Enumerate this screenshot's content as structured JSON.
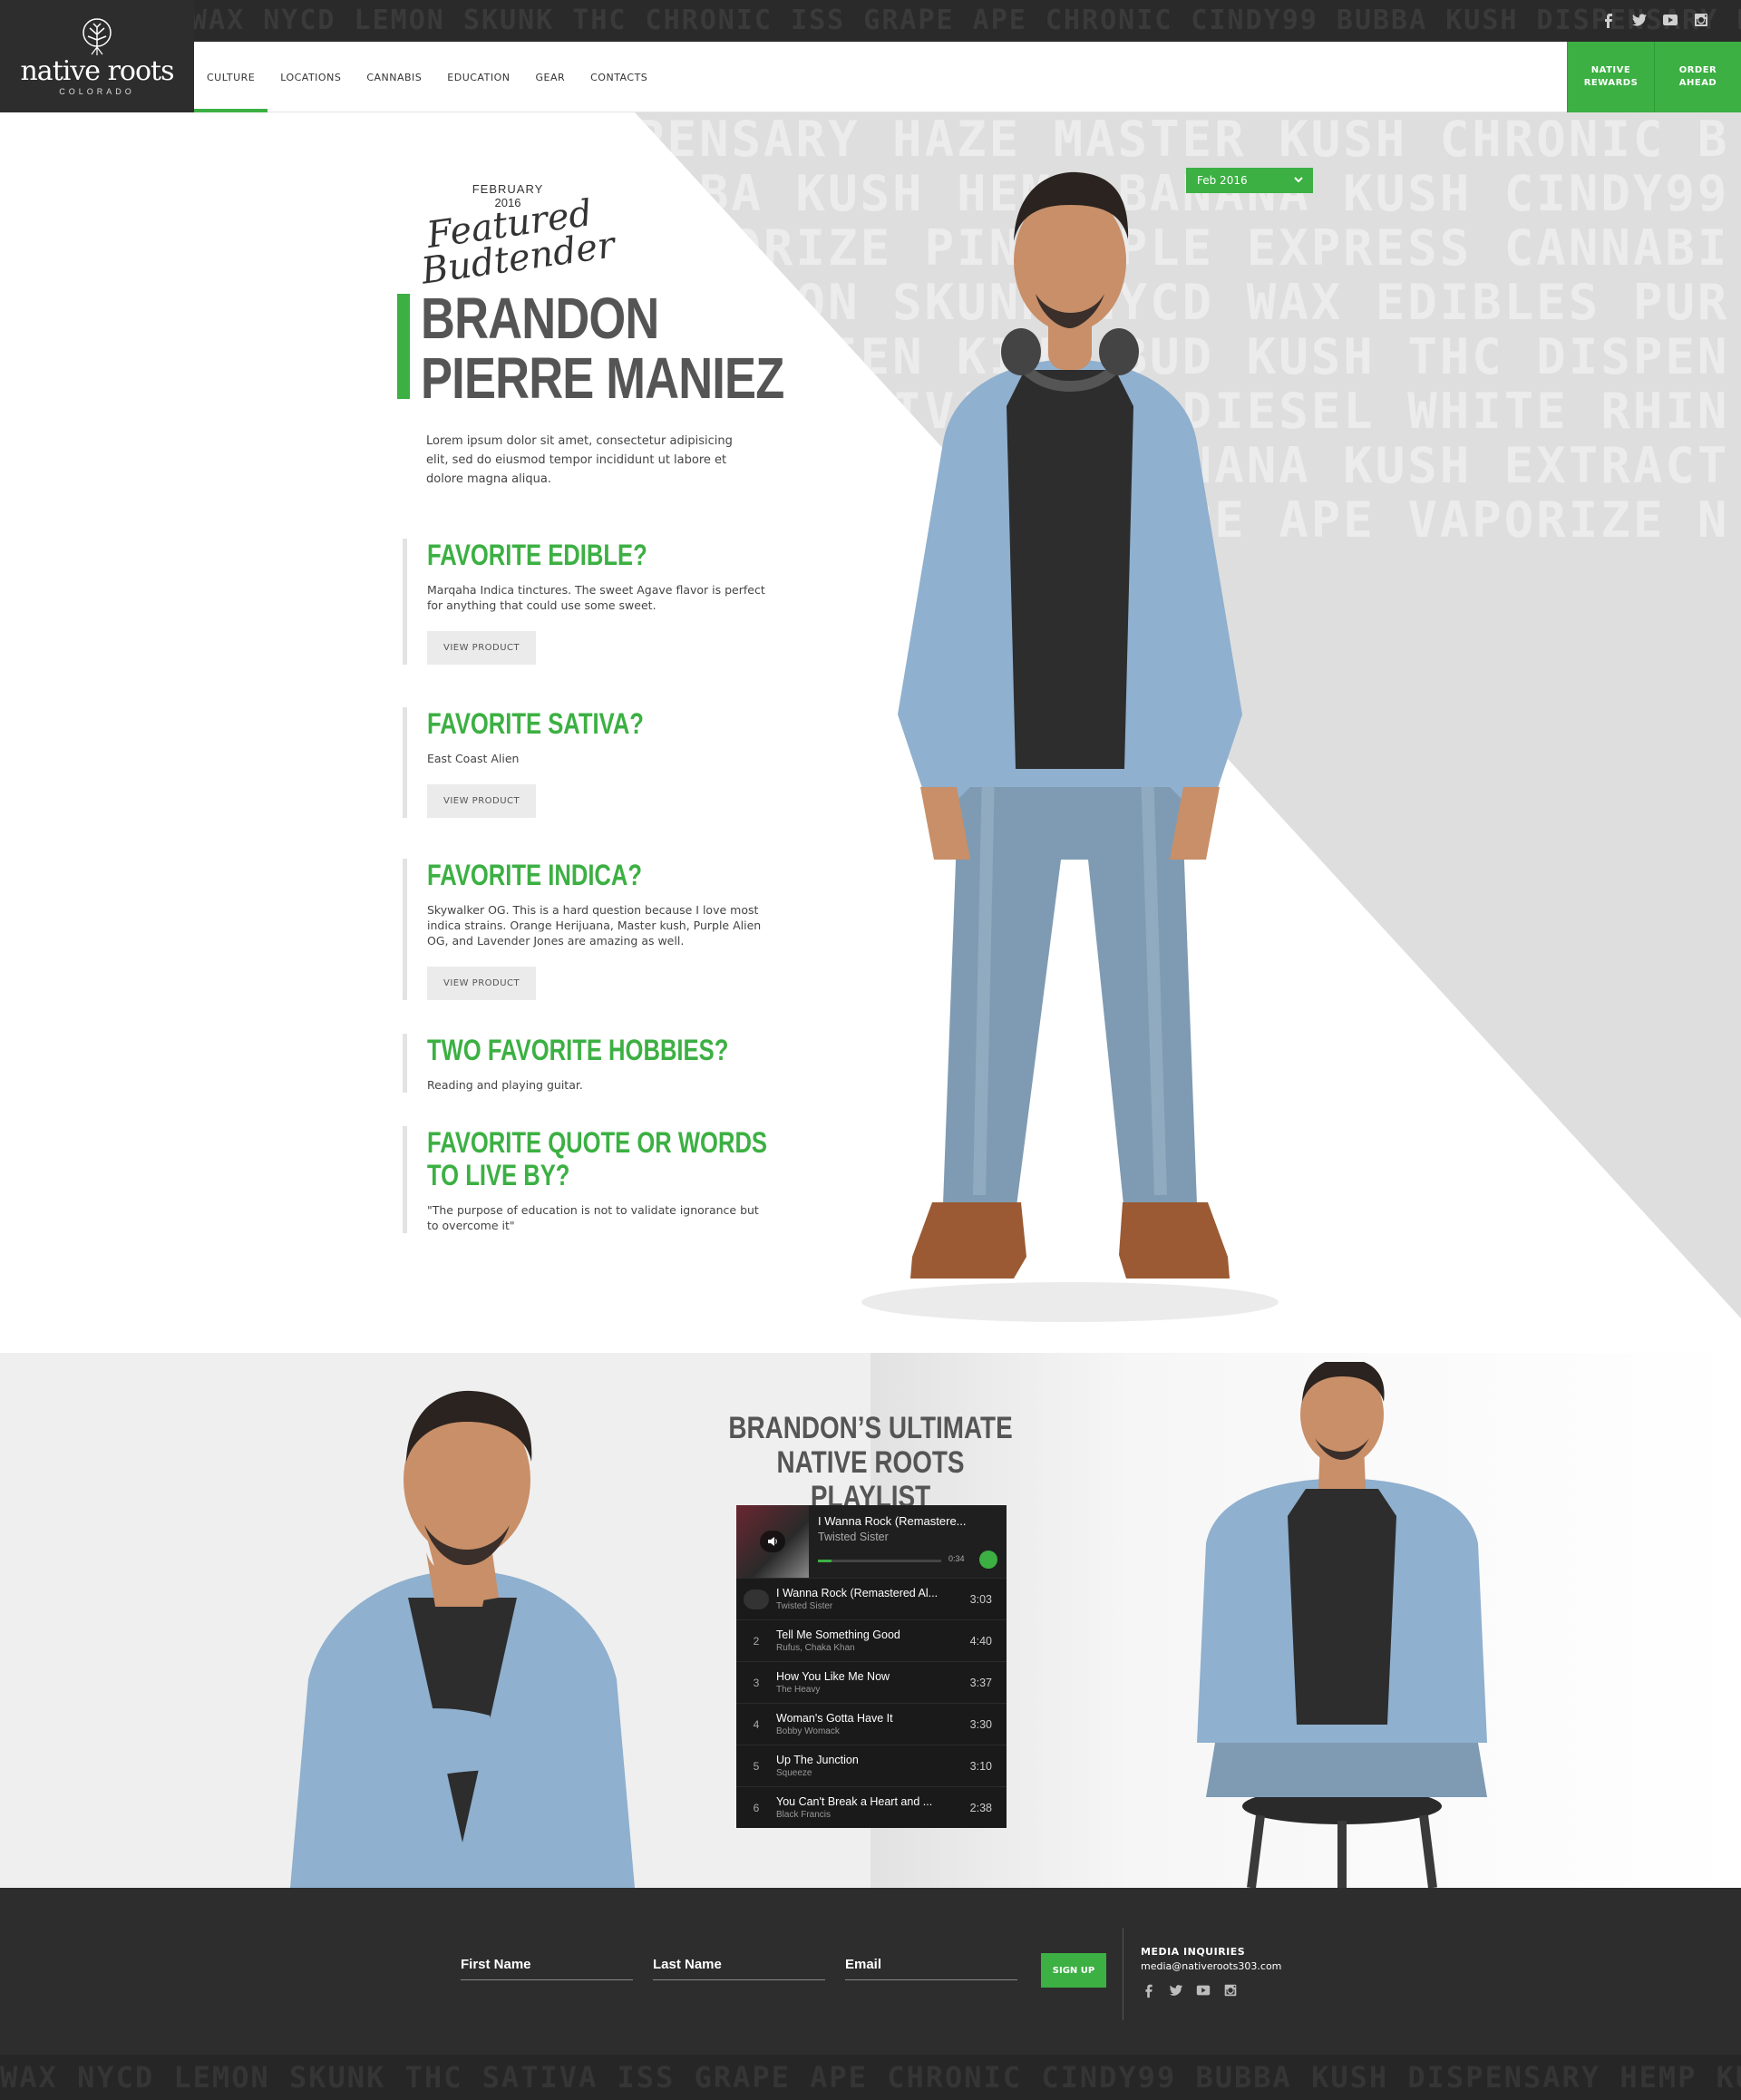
{
  "header": {
    "logo": {
      "word": "native roots",
      "sub": "COLORADO"
    },
    "nav": [
      {
        "label": "CULTURE",
        "active": true
      },
      {
        "label": "LOCATIONS",
        "active": false
      },
      {
        "label": "CANNABIS",
        "active": false
      },
      {
        "label": "EDUCATION",
        "active": false
      },
      {
        "label": "GEAR",
        "active": false
      },
      {
        "label": "CONTACTS",
        "active": false
      }
    ],
    "cta": [
      {
        "label": "NATIVE\nREWARDS"
      },
      {
        "label": "ORDER\nAHEAD"
      }
    ],
    "social_icons": [
      "facebook-icon",
      "twitter-icon",
      "youtube-icon",
      "instagram-icon"
    ],
    "strip_words": "WAX NYCD LEMON SKUNK THC CHRONIC ISS GRAPE APE CHRONIC CINDY99 BUBBA KUSH DISPENSARY HEMP KUSH GROWN LOVE THC PURPLE ALIEN"
  },
  "hero": {
    "featured": {
      "month": "FEBRUARY",
      "year": "2016",
      "script_line1": "Featured",
      "script_line2": "Budtender"
    },
    "name_line1": "BRANDON",
    "name_line2": "PIERRE MANIEZ",
    "intro": "Lorem ipsum dolor sit amet, consectetur adipisicing elit, sed do eiusmod tempor incididunt ut labore et dolore magna aliqua.",
    "date_select": "Feb 2016",
    "pattern_words": "PENSARY HAZE MASTER KUSH CHRONIC BUBBA KUSH HEMP BANANA KUSH CINDY99 VAPORIZE PINEAPPLE EXPRESS CANNABIS LEMON SKUNK NYCD WAX EDIBLES PURPLE ALIEN KIND BUD KUSH THC DISPENSARY SATIVA DANK DIESEL WHITE RHINO NATURAL HEMP BANANA KUSH EXTRACTS GOLDEN GOAT GRAPE APE VAPORIZE NATIVE ROOTS",
    "qa": [
      {
        "q": "FAVORITE EDIBLE?",
        "a": "Marqaha Indica tinctures. The sweet Agave flavor is perfect for anything that could use some sweet.",
        "button": "VIEW PRODUCT"
      },
      {
        "q": "FAVORITE SATIVA?",
        "a": "East Coast Alien",
        "button": "VIEW PRODUCT"
      },
      {
        "q": "FAVORITE INDICA?",
        "a": "Skywalker OG. This is a hard question because I love most indica strains. Orange Herijuana, Master kush, Purple Alien OG, and Lavender Jones are amazing as well.",
        "button": "VIEW PRODUCT"
      },
      {
        "q": "TWO FAVORITE HOBBIES?",
        "a": "Reading and playing guitar."
      },
      {
        "q_line1": "FAVORITE QUOTE OR WORDS",
        "q_line2": "TO LIVE BY?",
        "a": "\"The purpose of education is not to validate ignorance but to overcome it\""
      }
    ]
  },
  "playlist": {
    "title_line1": "BRANDON’S ULTIMATE",
    "title_line2": "NATIVE ROOTS PLAYLIST",
    "now_playing": {
      "title": "I Wanna Rock (Remastere...",
      "artist": "Twisted Sister",
      "time": "0:34",
      "progress": 0.11
    },
    "tracks": [
      {
        "num": "",
        "title": "I Wanna Rock (Remastered Al...",
        "artist": "Twisted Sister",
        "duration": "3:03"
      },
      {
        "num": "2",
        "title": "Tell Me Something Good",
        "artist": "Rufus, Chaka Khan",
        "duration": "4:40"
      },
      {
        "num": "3",
        "title": "How You Like Me Now",
        "artist": "The Heavy",
        "duration": "3:37"
      },
      {
        "num": "4",
        "title": "Woman's Gotta Have It",
        "artist": "Bobby Womack",
        "duration": "3:30"
      },
      {
        "num": "5",
        "title": "Up The Junction",
        "artist": "Squeeze",
        "duration": "3:10"
      },
      {
        "num": "6",
        "title": "You Can't Break a Heart and ...",
        "artist": "Black Francis",
        "duration": "2:38"
      }
    ]
  },
  "footer": {
    "first_name": "First Name",
    "last_name": "Last Name",
    "email": "Email",
    "signup": "SIGN UP",
    "media_heading": "MEDIA INQUIRIES",
    "media_email": "media@nativeroots303.com",
    "strip_words": "WAX NYCD LEMON SKUNK THC SATIVA ISS GRAPE APE CHRONIC CINDY99 BUBBA KUSH DISPENSARY HEMP KUSH GROWN LOVE PURPLE ALIEN NATURAL CBD TANGERINE DREAM GOLDEN GOAT ISS"
  },
  "colors": {
    "accent": "#3cb043",
    "dark": "#2d2d2d",
    "pattern": "#dedede"
  }
}
